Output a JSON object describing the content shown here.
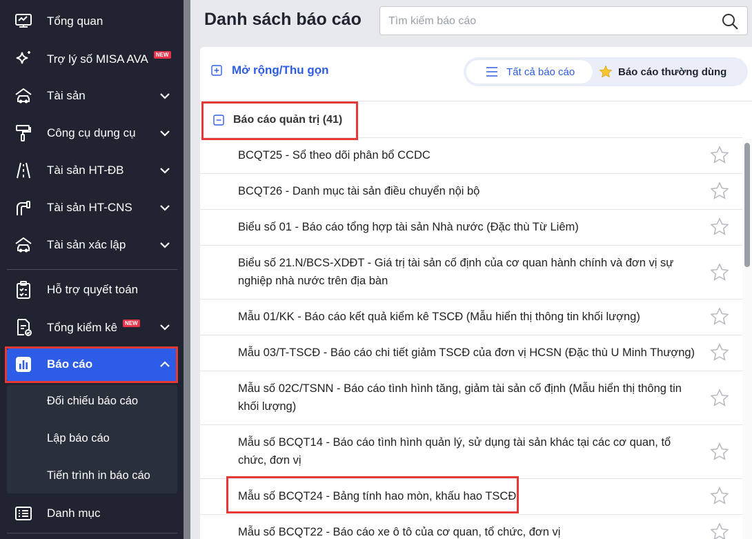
{
  "sidebar": {
    "items": [
      {
        "label": "Tổng quan",
        "icon": "monitor-chart-icon"
      },
      {
        "label": "Trợ lý số MISA AVA",
        "icon": "sparkle-icon",
        "badge": "NEW"
      },
      {
        "label": "Tài sản",
        "icon": "car-house-icon"
      },
      {
        "label": "Công cụ dụng cụ",
        "icon": "paint-roller-icon"
      },
      {
        "label": "Tài sản HT-ĐB",
        "icon": "road-icon"
      },
      {
        "label": "Tài sản HT-CNS",
        "icon": "water-pipe-icon"
      },
      {
        "label": "Tài sản xác lập",
        "icon": "car-house-icon"
      },
      {
        "label": "Hỗ trợ quyết toán",
        "icon": "clipboard-check-icon"
      },
      {
        "label": "Tổng kiểm kê",
        "icon": "document-check-icon",
        "badge": "NEW"
      },
      {
        "label": "Báo cáo",
        "icon": "bar-chart-icon"
      },
      {
        "label": "Danh mục",
        "icon": "list-icon"
      }
    ],
    "submenu": [
      "Đối chiếu báo cáo",
      "Lập báo cáo",
      "Tiến trình in báo cáo"
    ]
  },
  "header": {
    "title": "Danh sách báo cáo",
    "search_placeholder": "Tìm kiếm báo cáo"
  },
  "toolbar": {
    "expand_label": "Mở rộng/Thu gọn",
    "tab_all": "Tất cả báo cáo",
    "tab_favorite": "Báo cáo thường dùng"
  },
  "group": {
    "label": "Báo cáo quản trị (41)"
  },
  "reports": [
    "BCQT25 - Sổ theo dõi phân bổ CCDC",
    "BCQT26 - Danh mục tài sản điều chuyển nội bộ",
    "Biểu số 01 - Báo cáo tổng hợp tài sản Nhà nước (Đặc thù Từ Liêm)",
    "Biểu số 21.N/BCS-XDĐT - Giá trị tài sản cố định của cơ quan hành chính và đơn vị sự nghiệp nhà nước trên địa bàn",
    "Mẫu 01/KK - Báo cáo kết quả kiểm kê TSCĐ (Mẫu hiển thị thông tin khối lượng)",
    "Mẫu 03/T-TSCĐ - Báo cáo chi tiết giảm TSCĐ của đơn vị HCSN (Đặc thù U Minh Thượng)",
    "Mẫu số 02C/TSNN - Báo cáo tình hình tăng, giảm tài sản cố định (Mẫu hiển thị thông tin khối lượng)",
    "Mẫu số BCQT14 - Báo cáo tình hình quản lý, sử dụng tài sản khác tại các cơ quan, tổ chức, đơn vị",
    "Mẫu số BCQT24 - Bảng tính hao mòn, khấu hao TSCĐ",
    "Mẫu số BCQT22 - Báo cáo xe ô tô của cơ quan, tổ chức, đơn vị"
  ],
  "colors": {
    "accent": "#2d5de6",
    "highlight": "#e53935",
    "sidebar_bg": "#1f2430"
  }
}
